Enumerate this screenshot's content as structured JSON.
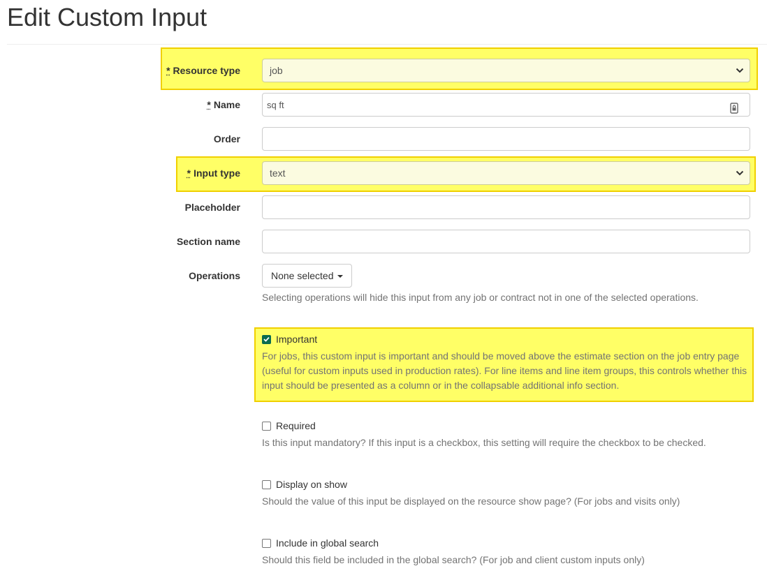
{
  "page": {
    "title": "Edit Custom Input"
  },
  "colors": {
    "highlight": "#ffff66",
    "highlight_border": "#f0d000",
    "checkbox_checked": "#0a6b4f",
    "help_text": "#737373"
  },
  "form": {
    "required_marker": "*",
    "resource_type": {
      "label": "Resource type",
      "value": "job"
    },
    "name": {
      "label": "Name",
      "value": "sq ft",
      "icon": "keypass-icon"
    },
    "order": {
      "label": "Order",
      "value": ""
    },
    "input_type": {
      "label": "Input type",
      "value": "text"
    },
    "placeholder": {
      "label": "Placeholder",
      "value": ""
    },
    "section_name": {
      "label": "Section name",
      "value": ""
    },
    "operations": {
      "label": "Operations",
      "button": "None selected",
      "help": "Selecting operations will hide this input from any job or contract not in one of the selected operations."
    },
    "important": {
      "label": "Important",
      "checked": true,
      "help": "For jobs, this custom input is important and should be moved above the estimate section on the job entry page (useful for custom inputs used in production rates). For line items and line item groups, this controls whether this input should be presented as a column or in the collapsable additional info section."
    },
    "required": {
      "label": "Required",
      "checked": false,
      "help": "Is this input mandatory? If this input is a checkbox, this setting will require the checkbox to be checked."
    },
    "display_on_show": {
      "label": "Display on show",
      "checked": false,
      "help": "Should the value of this input be displayed on the resource show page? (For jobs and visits only)"
    },
    "global_search": {
      "label": "Include in global search",
      "checked": false,
      "help": "Should this field be included in the global search? (For job and client custom inputs only)"
    }
  }
}
